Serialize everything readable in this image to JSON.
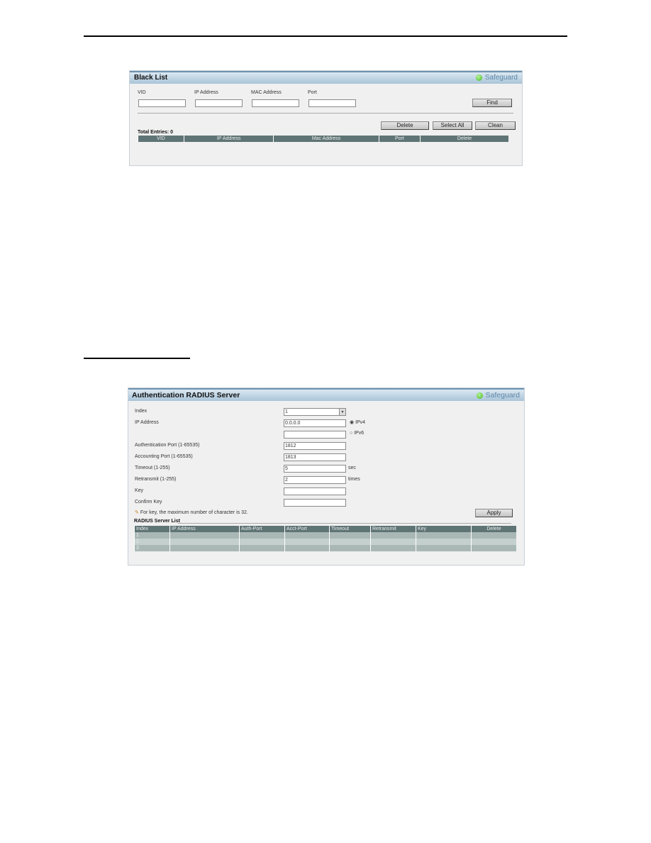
{
  "black_list": {
    "title": "Black List",
    "status": "Safeguard",
    "fields": [
      {
        "label": "VID",
        "value": ""
      },
      {
        "label": "IP Address",
        "value": ""
      },
      {
        "label": "MAC Address",
        "value": ""
      },
      {
        "label": "Port",
        "value": ""
      }
    ],
    "find": "Find",
    "delete": "Delete",
    "select_all": "Select All",
    "clean": "Clean",
    "total": "Total Entries: 0",
    "columns": [
      "VID",
      "IP Address",
      "Mac Address",
      "Port",
      "Delete"
    ]
  },
  "radius": {
    "title": "Authentication RADIUS Server",
    "status": "Safeguard",
    "index_label": "Index",
    "index_value": "1",
    "ip_label": "IP Address",
    "ipv4_value": "0.0.0.0",
    "ipv4": "IPv4",
    "ipv6_value": "",
    "ipv6": "IPv6",
    "ip_type": "IPv4",
    "auth_label": "Authentication Port (1-65535)",
    "auth_value": "1812",
    "acct_label": "Accounting Port (1-65535)",
    "acct_value": "1813",
    "timeout_label": "Timeout (1-255)",
    "timeout_value": "5",
    "timeout_unit": "sec",
    "retx_label": "Retransmit (1-255)",
    "retx_value": "2",
    "retx_unit": "times",
    "key_label": "Key",
    "key_value": "",
    "confirm_label": "Confirm Key",
    "confirm_value": "",
    "note": "For key, the maximum number of character is 32.",
    "apply": "Apply",
    "list_title": "RADIUS Server List",
    "columns": [
      "Index",
      "IP Address",
      "Auth-Port",
      "Acct-Port",
      "Timeout",
      "Retransmit",
      "Key",
      "Delete"
    ],
    "rows": [
      "1",
      "2",
      "3"
    ]
  },
  "colors": {
    "header_row": "#5f7475",
    "row": "#a9b8b5",
    "status_dot": "#3cb71c"
  }
}
